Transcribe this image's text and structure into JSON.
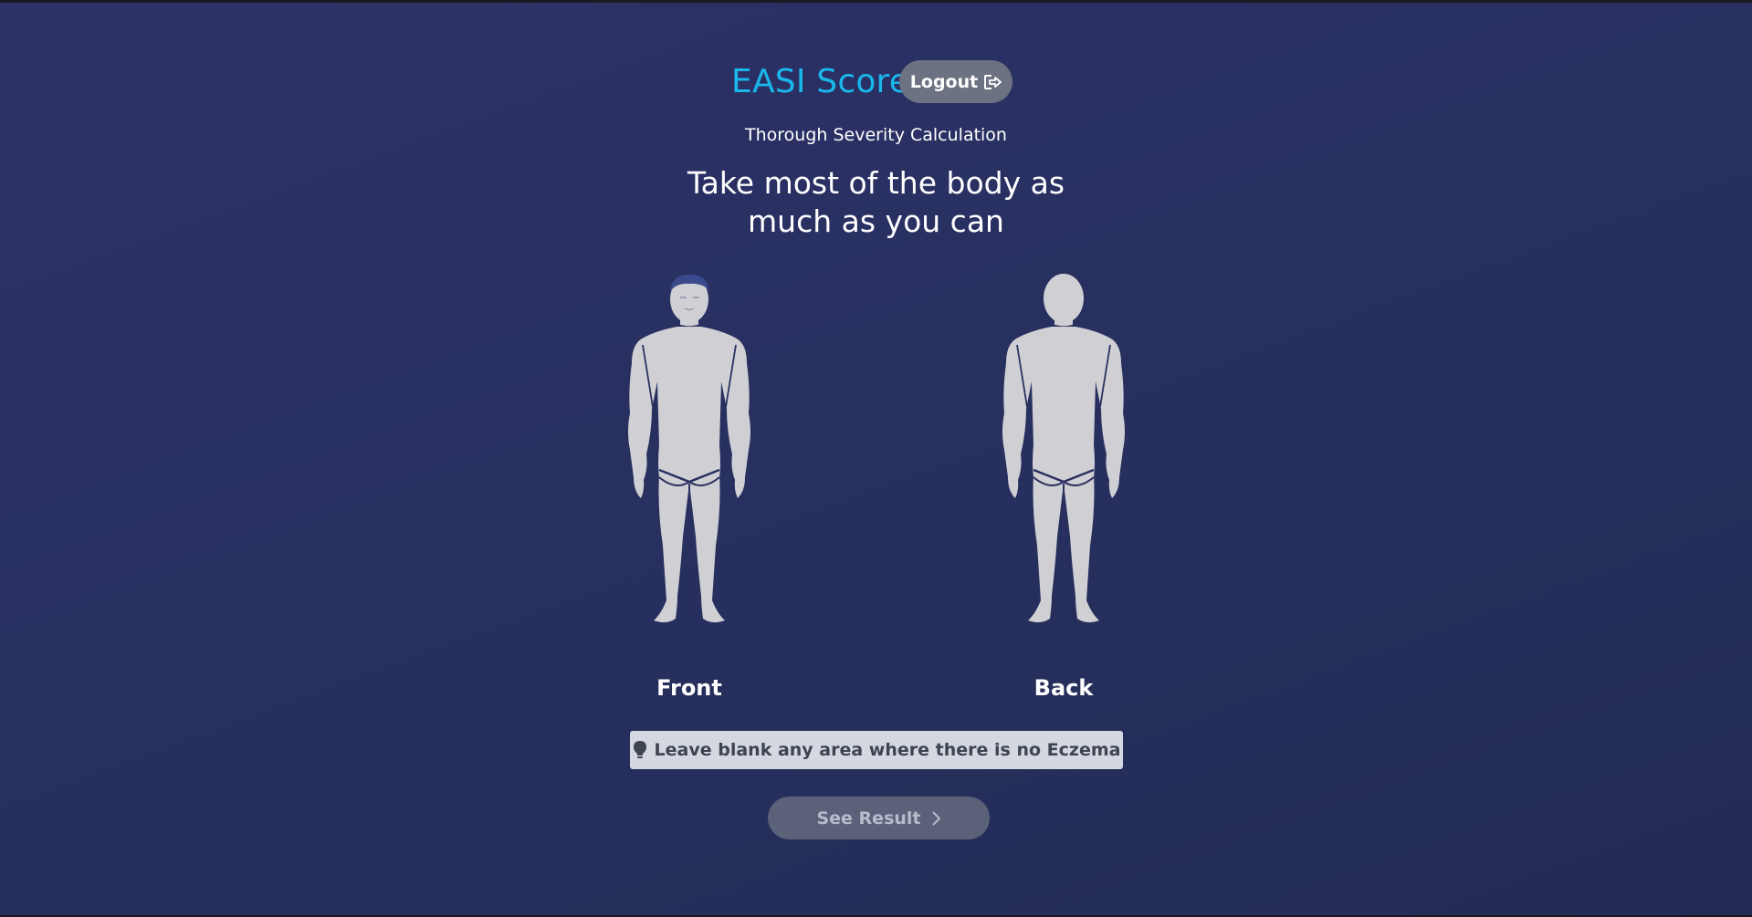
{
  "header": {
    "title": "EASI Score",
    "logout_label": "Logout",
    "logout_icon": "logout-icon"
  },
  "subtitle": "Thorough Severity Calculation",
  "instruction": {
    "line1": "Take most of the body as",
    "line2": "much as you can"
  },
  "figures": [
    {
      "label": "Front",
      "icon": "body-front-icon"
    },
    {
      "label": "Back",
      "icon": "body-back-icon"
    }
  ],
  "tip": {
    "icon": "lightbulb-icon",
    "text": "Leave blank any area where there is no Eczema"
  },
  "actions": {
    "see_result_label": "See Result",
    "see_result_icon": "chevron-right-icon",
    "see_result_enabled": false
  },
  "colors": {
    "background": "#2a3060",
    "title_accent": "#1ab7ea",
    "button_gray": "#6c7281",
    "figure_fill": "#d0d0d4",
    "tip_background": "#d3d8e1"
  }
}
